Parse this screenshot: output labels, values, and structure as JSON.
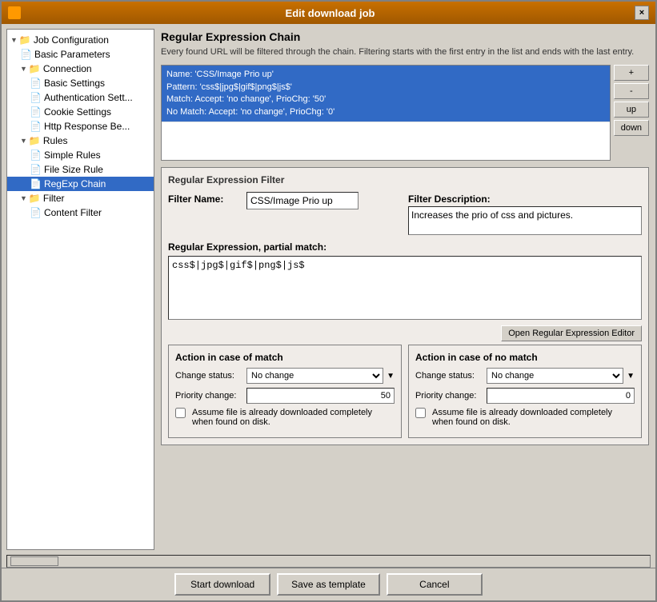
{
  "window": {
    "title": "Edit download job",
    "close_label": "×"
  },
  "sidebar": {
    "items": [
      {
        "id": "job-config",
        "label": "Job Configuration",
        "level": 0,
        "type": "folder",
        "expanded": true
      },
      {
        "id": "basic-params",
        "label": "Basic Parameters",
        "level": 1,
        "type": "file"
      },
      {
        "id": "connection",
        "label": "Connection",
        "level": 1,
        "type": "folder",
        "expanded": true
      },
      {
        "id": "basic-settings",
        "label": "Basic Settings",
        "level": 2,
        "type": "file"
      },
      {
        "id": "auth-settings",
        "label": "Authentication Sett...",
        "level": 2,
        "type": "file"
      },
      {
        "id": "cookie-settings",
        "label": "Cookie Settings",
        "level": 2,
        "type": "file"
      },
      {
        "id": "http-response",
        "label": "Http Response Be...",
        "level": 2,
        "type": "file"
      },
      {
        "id": "rules",
        "label": "Rules",
        "level": 1,
        "type": "folder",
        "expanded": true
      },
      {
        "id": "simple-rules",
        "label": "Simple Rules",
        "level": 2,
        "type": "file"
      },
      {
        "id": "file-size-rule",
        "label": "File Size Rule",
        "level": 2,
        "type": "file"
      },
      {
        "id": "regexp-chain",
        "label": "RegExp Chain",
        "level": 2,
        "type": "file",
        "selected": true
      },
      {
        "id": "filter",
        "label": "Filter",
        "level": 1,
        "type": "folder",
        "expanded": true
      },
      {
        "id": "content-filter",
        "label": "Content Filter",
        "level": 2,
        "type": "file"
      }
    ]
  },
  "main": {
    "chain_section": {
      "title": "Regular Expression Chain",
      "description": "Every found URL will be filtered through the chain. Filtering starts with the first entry in the list and ends with the last entry.",
      "list_items": [
        {
          "name_line": "Name: 'CSS/Image Prio up'",
          "pattern_line": "Pattern: 'css$|jpg$|gif$|png$|js$'",
          "match_line": "Match: Accept: 'no change', PrioChg: '50'",
          "nomatch_line": "No Match: Accept: 'no change', PrioChg: '0'",
          "selected": true
        }
      ],
      "buttons": {
        "add": "+",
        "remove": "-",
        "up": "up",
        "down": "down"
      }
    },
    "filter_section": {
      "title": "Regular Expression Filter",
      "filter_name_label": "Filter Name:",
      "filter_name_value": "CSS/Image Prio up",
      "filter_desc_label": "Filter Description:",
      "filter_desc_value": "Increases the prio of css and pictures.",
      "regex_label": "Regular Expression, partial match:",
      "regex_value": "css$|jpg$|gif$|png$|js$",
      "open_editor_label": "Open Regular Expression Editor"
    },
    "match_section": {
      "match_title": "Action in case of match",
      "match_change_status_label": "Change status:",
      "match_change_status_value": "No change",
      "match_priority_label": "Priority change:",
      "match_priority_value": "50",
      "match_assume_label": "Assume file is already downloaded completely when found on disk.",
      "nomatch_title": "Action in case of no match",
      "nomatch_change_status_label": "Change status:",
      "nomatch_change_status_value": "No change",
      "nomatch_priority_label": "Priority change:",
      "nomatch_priority_value": "0",
      "nomatch_assume_label": "Assume file is already downloaded completely when found on disk."
    }
  },
  "footer": {
    "start_download_label": "Start download",
    "save_template_label": "Save as template",
    "cancel_label": "Cancel"
  }
}
